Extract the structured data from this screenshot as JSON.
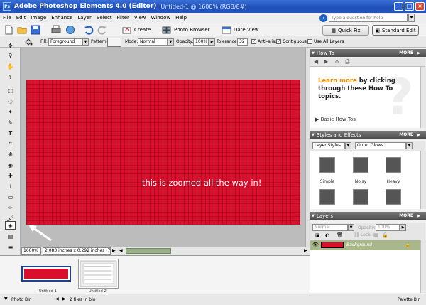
{
  "window": {
    "app_title": "Adobe Photoshop Elements 4.0 (Editor)",
    "doc_title": "Untitled-1 @ 1600% (RGB/8#)"
  },
  "menu": [
    "File",
    "Edit",
    "Image",
    "Enhance",
    "Layer",
    "Select",
    "Filter",
    "View",
    "Window",
    "Help"
  ],
  "help": {
    "placeholder": "Type a question for help"
  },
  "shortcuts": {
    "create": "Create",
    "photo_browser": "Photo Browser",
    "date_view": "Date View",
    "quick_fix": "Quick Fix",
    "standard_edit": "Standard Edit"
  },
  "options": {
    "fill_label": "Fill:",
    "fill_value": "Foreground",
    "pattern_label": "Pattern:",
    "mode_label": "Mode:",
    "mode_value": "Normal",
    "opacity_label": "Opacity:",
    "opacity_value": "100%",
    "tolerance_label": "Tolerance:",
    "tolerance_value": "32",
    "anti_alias": "Anti-alias",
    "contiguous": "Contiguous",
    "use_all_layers": "Use All Layers"
  },
  "canvas": {
    "annotation": "this is zoomed all the way in!",
    "zoom": "1600%",
    "doc_info": "2.083 inches x 0.292 inches (72 ppi)",
    "fill_color": "#d8102c"
  },
  "photo_bin": {
    "items": [
      "Untitled-1",
      "Untitled-2"
    ],
    "status_label": "Photo Bin",
    "file_count": "2 files in bin",
    "palette_bin": "Palette Bin"
  },
  "palettes": {
    "how_to": {
      "title": "How To",
      "more": "MORE",
      "highlight": "Learn more",
      "body": "by clicking through these How To topics.",
      "topic": "Basic How Tos"
    },
    "styles": {
      "title": "Styles and Effects",
      "more": "MORE",
      "category": "Layer Styles",
      "subcategory": "Outer Glows",
      "effects": [
        "Simple",
        "Noisy",
        "Heavy"
      ]
    },
    "layers": {
      "title": "Layers",
      "more": "MORE",
      "mode": "Normal",
      "opacity_label": "Opacity:",
      "opacity": "100%",
      "lock_label": "Lock:",
      "layer_name": "Background"
    }
  }
}
